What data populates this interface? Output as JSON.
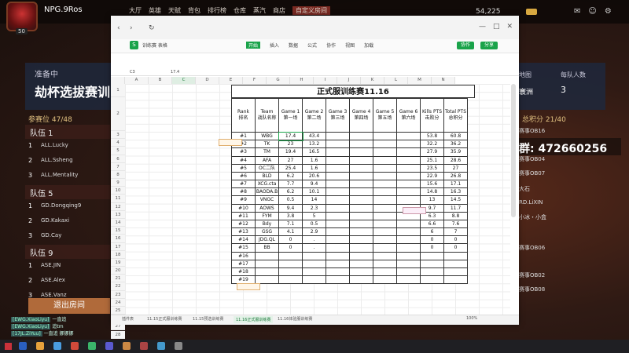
{
  "game": {
    "player_name": "NPG.9Ros",
    "level": "50",
    "menu": [
      "大厅",
      "英雄",
      "天赋",
      "背包",
      "排行榜",
      "仓库",
      "蒸汽",
      "商店",
      "自定义房间"
    ],
    "active_menu_index": 8,
    "currency_value": "54,225",
    "gold_value": "",
    "status_label": "准备中",
    "status_title": "劫杯选拔赛训",
    "slot_count": "参赛位 47/48",
    "teams": [
      {
        "name": "队伍 1",
        "members": [
          "ALL.Lucky",
          "ALL.Ssheng",
          "ALL.Mentality"
        ]
      },
      {
        "name": "队伍 5",
        "members": [
          "GD.Dongqing9",
          "GD.Kakaxi",
          "GD.Cay"
        ]
      },
      {
        "name": "队伍 9",
        "members": [
          "ASE.JIN",
          "ASE.Alex",
          "ASE.Vanz"
        ]
      }
    ],
    "leave_button": "退出房间",
    "right_map_label": "地图",
    "right_map_value": "寰洲",
    "right_team_label": "每队人数",
    "right_team_value": "3",
    "right_count": "总积分 21/40",
    "right_items": [
      "赛事OB16",
      "赛事OB04",
      "赛事OB07",
      "大石",
      "RD.LiXIN",
      "小冰・小盒",
      "赛事OB06",
      "赛事OB02",
      "赛事OB08"
    ],
    "qq_text": "群: 472660256",
    "chat": [
      {
        "badge": "[EWG.XiaoLiyu]",
        "text": "一直追"
      },
      {
        "badge": "[EWG.XiaoLiyu]",
        "text": "追tm"
      },
      {
        "badge": "[17JL.ZiYuu]",
        "text": "一直追 挪挪挪"
      }
    ]
  },
  "window": {
    "file_name": "训练赛 表格",
    "menu_tabs": [
      "开始",
      "插入",
      "数据",
      "公式",
      "协作",
      "视图",
      "加载"
    ],
    "active_tab_index": 0,
    "share_label": "协作",
    "share_label_2": "分享",
    "cell_ref": "C3",
    "formula_value": "17.4",
    "sheet_tabs": [
      "插件表",
      "11.15正式服训练赛",
      "11.15预选训练赛",
      "11.16正式服训练赛",
      "11.16体验服训练赛"
    ],
    "active_sheet_index": 3,
    "zoom": "100%"
  },
  "columns": [
    "",
    "A",
    "B",
    "C",
    "D",
    "E",
    "F",
    "G",
    "H",
    "I",
    "J",
    "K",
    "L",
    "M",
    "N"
  ],
  "table": {
    "title": "正式服训练赛11.16",
    "headers": [
      "Rank\n排名",
      "Team\n战队名称",
      "Game 1\n第一场",
      "Game 2\n第二场",
      "Game 3\n第三场",
      "Game 4\n第四场",
      "Game 5\n第五场",
      "Game 6\n第六场",
      "Kills PTS\n击败分",
      "Total PTS\n总积分"
    ],
    "rows": [
      [
        "#1",
        "WBG",
        "17.4",
        "43.4",
        "",
        "",
        "",
        "",
        "53.8",
        "60.8"
      ],
      [
        "#2",
        "TK",
        "23",
        "13.2",
        "",
        "",
        "",
        "",
        "32.2",
        "36.2"
      ],
      [
        "#3",
        "TM",
        "19.4",
        "16.5",
        "",
        "",
        "",
        "",
        "27.9",
        "35.9"
      ],
      [
        "#4",
        "AFA",
        "27",
        "1.6",
        "",
        "",
        "",
        "",
        "25.1",
        "28.6"
      ],
      [
        "#5",
        "OC二队",
        "25.4",
        "1.6",
        "",
        "",
        "",
        "",
        "23.5",
        "27"
      ],
      [
        "#6",
        "BLD",
        "6.2",
        "20.6",
        "",
        "",
        "",
        "",
        "22.9",
        "26.8"
      ],
      [
        "#7",
        "XCG.cta",
        "7.7",
        "9.4",
        "",
        "",
        "",
        "",
        "15.6",
        "17.1"
      ],
      [
        "#8",
        "BAODA.B",
        "6.2",
        "10.1",
        "",
        "",
        "",
        "",
        "14.8",
        "16.3"
      ],
      [
        "#9",
        "VNGC",
        "0.5",
        "14",
        "",
        "",
        "",
        "",
        "13",
        "14.5"
      ],
      [
        "#10",
        "AOWS",
        "9.4",
        "2.3",
        "",
        "",
        "",
        "",
        "9.7",
        "11.7"
      ],
      [
        "#11",
        "FYM",
        "3.8",
        "5",
        "",
        "",
        "",
        "",
        "6.3",
        "8.8"
      ],
      [
        "#12",
        "Bdy",
        "7.1",
        "0.5",
        "",
        "",
        "",
        "",
        "6.6",
        "7.6"
      ],
      [
        "#13",
        "GSG",
        "4.1",
        "2.9",
        "",
        "",
        "",
        "",
        "6",
        "7"
      ],
      [
        "#14",
        "JDG.QL",
        "0",
        ".",
        "",
        "",
        "",
        "",
        "0",
        "0"
      ],
      [
        "#15",
        "BB",
        "0",
        ".",
        "",
        "",
        "",
        "",
        "0",
        "0"
      ],
      [
        "#16",
        "",
        "",
        "",
        "",
        "",
        "",
        "",
        "",
        ""
      ],
      [
        "#17",
        "",
        "",
        "",
        "",
        "",
        "",
        "",
        "",
        ""
      ],
      [
        "#18",
        "",
        "",
        "",
        "",
        "",
        "",
        "",
        "",
        ""
      ],
      [
        "#19",
        "",
        "",
        "",
        "",
        "",
        "",
        "",
        "",
        ""
      ]
    ]
  },
  "row_numbers": [
    "1",
    "2",
    "3",
    "4",
    "5",
    "6",
    "7",
    "8",
    "9",
    "10",
    "11",
    "12",
    "13",
    "14",
    "15",
    "16",
    "17",
    "18",
    "19",
    "20",
    "21",
    "22",
    "23",
    "24",
    "25",
    "26",
    "27",
    "28"
  ]
}
